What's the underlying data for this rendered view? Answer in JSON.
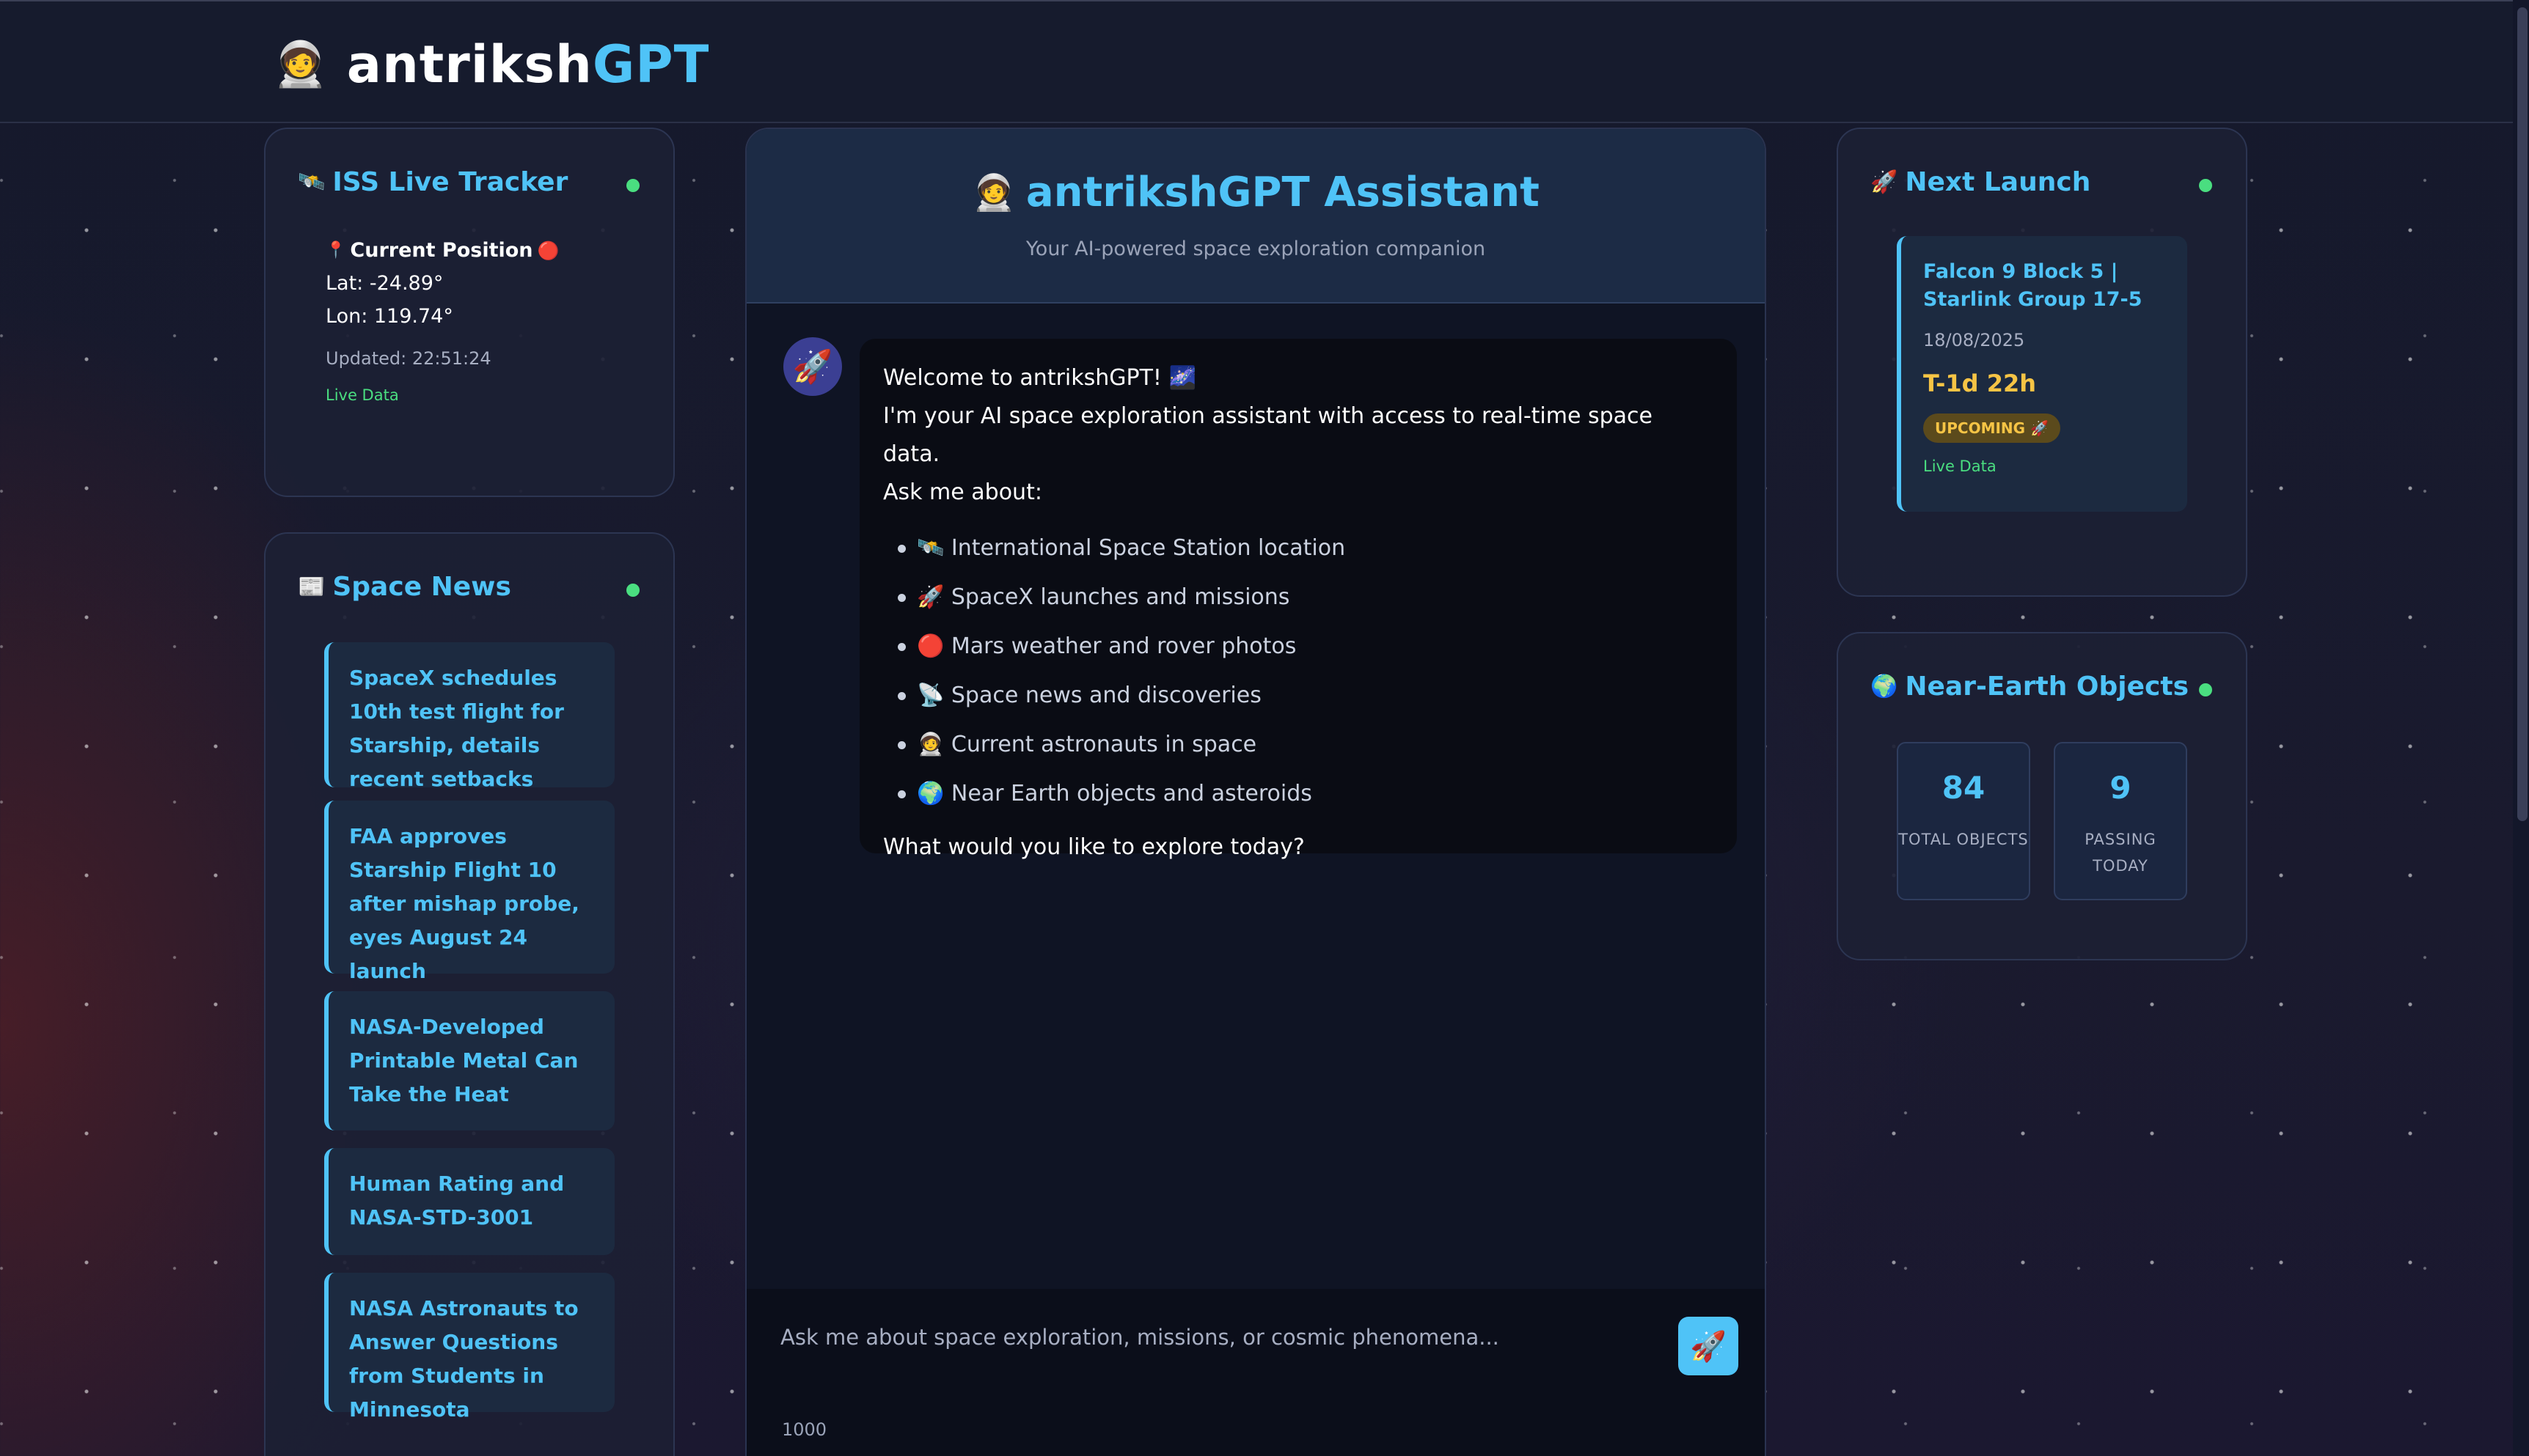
{
  "header": {
    "icon": "astronaut-icon",
    "brand_main": "antriksh",
    "brand_accent": "GPT"
  },
  "iss": {
    "icon": "satellite-icon",
    "title": "ISS Live Tracker",
    "position_label": "Current Position",
    "lat": "Lat: -24.89°",
    "lon": "Lon: 119.74°",
    "updated": "Updated: 22:51:24",
    "live": "Live Data",
    "status_color": "#4ade80"
  },
  "news": {
    "icon": "newspaper-icon",
    "title": "Space News",
    "items": [
      "SpaceX schedules 10th test flight for Starship, details recent setbacks",
      "FAA approves Starship Flight 10 after mishap probe, eyes August 24 launch",
      "NASA-Developed Printable Metal Can Take the Heat",
      "Human Rating and NASA-STD-3001",
      "NASA Astronauts to Answer Questions from Students in Minnesota"
    ]
  },
  "chat": {
    "title": "antrikshGPT Assistant",
    "subtitle": "Your AI-powered space exploration companion",
    "welcome": "Welcome to antrikshGPT! 🌌",
    "intro": "I'm your AI space exploration assistant with access to real-time space data.",
    "ask": "Ask me about:",
    "topics": [
      "🛰️ International Space Station location",
      "🚀 SpaceX launches and missions",
      "🔴 Mars weather and rover photos",
      "📡 Space news and discoveries",
      "🧑‍🚀 Current astronauts in space",
      "🌍 Near Earth objects and asteroids"
    ],
    "closing": "What would you like to explore today?",
    "input_placeholder": "Ask me about space exploration, missions, or cosmic phenomena...",
    "char_count": "1000",
    "accent_color": "#4fc3f7"
  },
  "launch": {
    "icon": "rocket-icon",
    "title": "Next Launch",
    "name": "Falcon 9 Block 5 | Starlink Group 17-5",
    "date": "18/08/2025",
    "countdown": "T-1d 22h",
    "status": "UPCOMING 🚀",
    "live": "Live Data"
  },
  "neo": {
    "icon": "globe-icon",
    "title": "Near-Earth Objects",
    "total_value": "84",
    "total_label": "TOTAL OBJECTS",
    "passing_value": "9",
    "passing_label": "PASSING TODAY"
  }
}
